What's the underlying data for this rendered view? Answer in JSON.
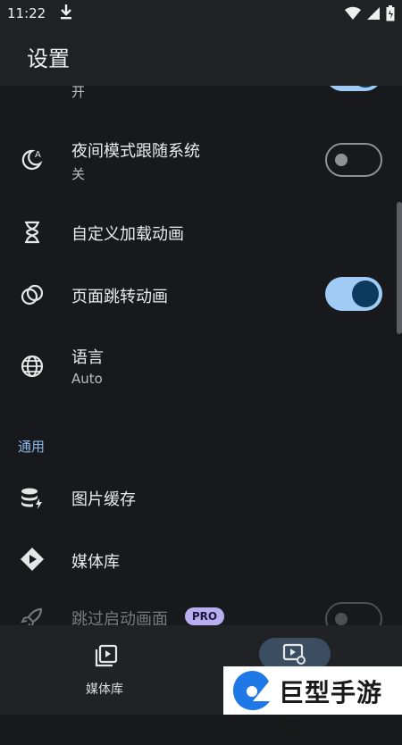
{
  "status_bar": {
    "time": "11:22"
  },
  "app_bar": {
    "title": "设置"
  },
  "settings": {
    "partial_top_sub": "开",
    "night_mode": {
      "title": "夜间模式跟随系统",
      "subtitle": "关",
      "enabled": false
    },
    "custom_loading_animation": {
      "title": "自定义加载动画"
    },
    "page_transition_animation": {
      "title": "页面跳转动画",
      "enabled": true
    },
    "language": {
      "title": "语言",
      "subtitle": "Auto"
    },
    "section_general": "通用",
    "image_cache": {
      "title": "图片缓存"
    },
    "media_library": {
      "title": "媒体库"
    },
    "skip_splash": {
      "title": "跳过启动画面",
      "badge": "PRO",
      "enabled": false
    }
  },
  "bottom_nav": {
    "items": [
      {
        "label": "媒体库",
        "icon": "video-library-icon"
      },
      {
        "label": "",
        "icon": "player-settings-icon",
        "selected": true
      }
    ]
  },
  "watermark": {
    "text": "巨型手游网"
  },
  "colors": {
    "accent": "#9fcbf5",
    "toggle_knob_on": "#0c3a5e",
    "section_header": "#8ab7e8",
    "background": "#17191c"
  }
}
